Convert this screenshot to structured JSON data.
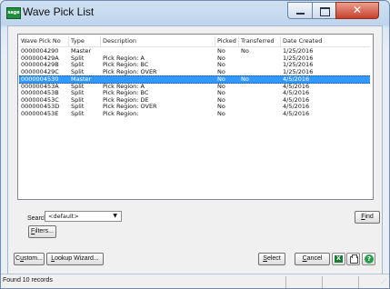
{
  "window": {
    "title": "Wave Pick List",
    "app_icon_text": "sage",
    "close_glyph": "✕"
  },
  "columns": [
    "Wave Pick No",
    "Type",
    "Description",
    "Picked",
    "Transferred",
    "Date Created"
  ],
  "rows": [
    {
      "no": "0000004290",
      "type": "Master",
      "desc": "",
      "picked": "No",
      "transferred": "No",
      "date": "1/25/2016"
    },
    {
      "no": "000000429A",
      "type": "Split",
      "desc": "Pick Region: A",
      "picked": "No",
      "transferred": "",
      "date": "1/25/2016"
    },
    {
      "no": "000000429B",
      "type": "Split",
      "desc": "Pick Region: BC",
      "picked": "No",
      "transferred": "",
      "date": "1/25/2016"
    },
    {
      "no": "000000429C",
      "type": "Split",
      "desc": "Pick Region: OVER",
      "picked": "No",
      "transferred": "",
      "date": "1/25/2016"
    },
    {
      "no": "0000004530",
      "type": "Master",
      "desc": "",
      "picked": "No",
      "transferred": "No",
      "date": "4/5/2016",
      "selected": true
    },
    {
      "no": "000000453A",
      "type": "Split",
      "desc": "Pick Region: A",
      "picked": "No",
      "transferred": "",
      "date": "4/5/2016"
    },
    {
      "no": "000000453B",
      "type": "Split",
      "desc": "Pick Region: BC",
      "picked": "No",
      "transferred": "",
      "date": "4/5/2016"
    },
    {
      "no": "000000453C",
      "type": "Split",
      "desc": "Pick Region: DE",
      "picked": "No",
      "transferred": "",
      "date": "4/5/2016"
    },
    {
      "no": "000000453D",
      "type": "Split",
      "desc": "Pick Region: OVER",
      "picked": "No",
      "transferred": "",
      "date": "4/5/2016"
    },
    {
      "no": "000000453E",
      "type": "Split",
      "desc": "Pick Region:",
      "picked": "No",
      "transferred": "",
      "date": "4/5/2016"
    }
  ],
  "search": {
    "label": "Search",
    "selected": "<default>",
    "find_label_u": "F",
    "find_label_rest": "ind",
    "filters_label_u": "F",
    "filters_label_rest": "ilters..."
  },
  "buttons": {
    "custom_u": "u",
    "custom_pre": "C",
    "custom_post": "stom...",
    "lookup_u": "L",
    "lookup_rest": "ookup Wizard...",
    "select_u": "S",
    "select_rest": "elect",
    "cancel_u": "C",
    "cancel_rest": "ancel",
    "excel_icon": "excel-icon",
    "print_icon": "printer-icon",
    "help_icon": "help-icon",
    "help_glyph": "?"
  },
  "status": {
    "text": "Found 10 records"
  },
  "colors": {
    "selection": "#3399ff",
    "close_button": "#c8402c"
  }
}
